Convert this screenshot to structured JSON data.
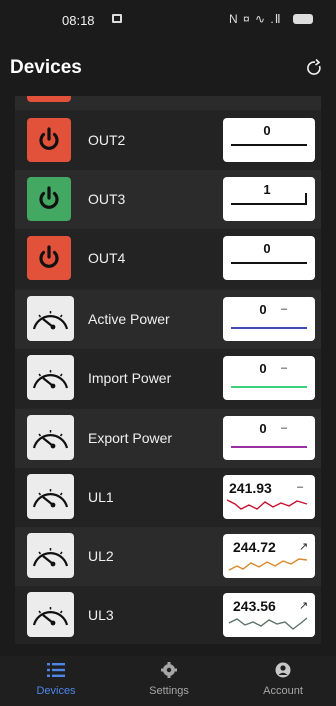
{
  "status_bar": {
    "time": "08:18",
    "right_icons": "N ¤ ∿ .Ⅱ",
    "icons": [
      "notification-icon",
      "nfc-icon",
      "mute-icon",
      "wifi-icon",
      "signal-icon",
      "battery-icon"
    ]
  },
  "header": {
    "title": "Devices",
    "refresh_icon": "refresh-icon"
  },
  "devices": [
    {
      "label": "OUT2",
      "kind": "switch",
      "state": "off",
      "value": "0",
      "trend": ""
    },
    {
      "label": "OUT3",
      "kind": "switch",
      "state": "on",
      "value": "1",
      "trend": ""
    },
    {
      "label": "OUT4",
      "kind": "switch",
      "state": "off",
      "value": "0",
      "trend": ""
    },
    {
      "label": "Active Power",
      "kind": "meter",
      "value": "0",
      "trend": "–",
      "line_color": "#3f4fb5"
    },
    {
      "label": "Import Power",
      "kind": "meter",
      "value": "0",
      "trend": "–",
      "line_color": "#39d27a"
    },
    {
      "label": "Export Power",
      "kind": "meter",
      "value": "0",
      "trend": "–",
      "line_color": "#9c2fa0"
    },
    {
      "label": "UL1",
      "kind": "meter",
      "value": "241.93",
      "trend": "–",
      "line_color": "#c8102e"
    },
    {
      "label": "UL2",
      "kind": "meter",
      "value": "244.72",
      "trend": "↗",
      "line_color": "#d9892a"
    },
    {
      "label": "UL3",
      "kind": "meter",
      "value": "243.56",
      "trend": "↗",
      "line_color": "#5d7368"
    }
  ],
  "colors": {
    "off": "#e2523a",
    "on": "#43a861",
    "accent": "#4e86e8"
  },
  "bottom_nav": [
    {
      "label": "Devices",
      "icon": "list-icon",
      "active": true
    },
    {
      "label": "Settings",
      "icon": "gear-icon",
      "active": false
    },
    {
      "label": "Account",
      "icon": "account-icon",
      "active": false
    }
  ]
}
